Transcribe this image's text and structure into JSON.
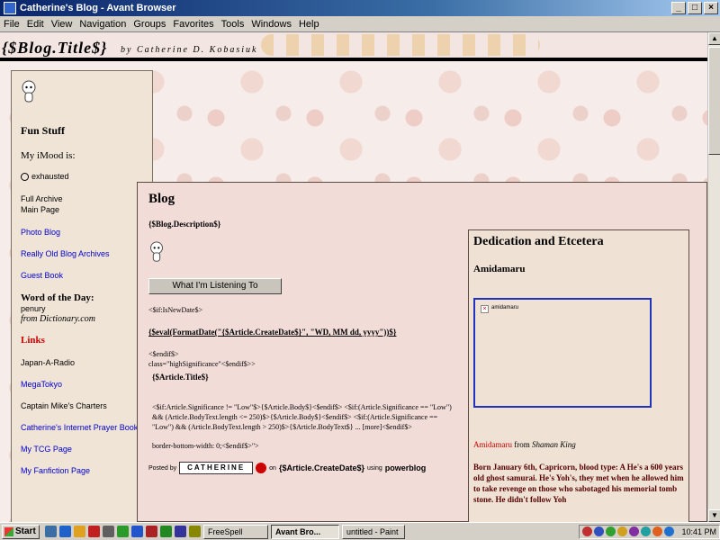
{
  "window": {
    "title": "Catherine's Blog - Avant Browser",
    "buttons": [
      "_",
      "□",
      "×"
    ]
  },
  "menu": [
    "File",
    "Edit",
    "View",
    "Navigation",
    "Groups",
    "Favorites",
    "Tools",
    "Windows",
    "Help"
  ],
  "blog": {
    "title": "{$Blog.Title$}",
    "byline": "by Catherine D. Kobasiuk"
  },
  "sidebar": {
    "fun_stuff": "Fun Stuff",
    "mood_label": "My iMood is:",
    "mood_value": "exhausted",
    "full_archive": "Full Archive",
    "main_page": "Main Page",
    "photo_blog": "Photo Blog",
    "old_archives": "Really Old Blog Archives",
    "guest_book": "Guest Book",
    "wotd_label": "Word of the Day:",
    "wotd_word": "penury",
    "wotd_source": "from Dictionary.com",
    "links_heading": "Links",
    "links": [
      "Japan-A-Radio",
      "MegaTokyo",
      "Captain Mike's Charters",
      "Catherine's Internet Prayer Book",
      "My TCG Page",
      "My Fanfiction Page"
    ]
  },
  "main": {
    "title": "Blog",
    "description": "{$Blog.Description$}",
    "listen_button": "What I'm Listening To",
    "code1": "<$if:IsNewDate$>",
    "code2": "{$eval(FormatDate(\"{$Article.CreateDate$}\", \"WD, MM dd, yyyy\"))$}",
    "code3": "<$endif$>",
    "code4": "class=\"highSignificance\"<$endif$>>",
    "article_title": "{$Article.Title$}",
    "code5": "<$if:Article.Significance != \"Low\"$>{$Article.Body$}<$endif$> <$if:(Article.Significance == \"Low\") && (Article.BodyText.length <= 250)$>{$Article.Body$}<$endif$> <$if:(Article.Significance == \"Low\") && (Article.BodyText.length > 250)$>{$Article.BodyText$} ... [more]<$endif$>",
    "code6": "border-bottom-width: 0;<$endif$>\">",
    "posted_by": "Posted by",
    "logo_text": "CATHERINE",
    "on_text": "on",
    "create_date": "{$Article.CreateDate$}",
    "using": "using",
    "powerblog": "powerblog"
  },
  "right_box": {
    "title": "Dedication and Etcetera",
    "subtitle": "Amidamaru",
    "image_alt": "amidamaru",
    "from_name": "Amidamaru",
    "from_word": "from",
    "from_source": "Shaman King",
    "body": "Born January 6th, Capricorn, blood type: A He's a 600 years old ghost samurai. He's Yoh's, they met when he allowed him to take revenge on those who sabotaged his memorial tomb stone. He didn't follow Yoh"
  },
  "taskbar": {
    "start": "Start",
    "tasks": [
      "FreeSpell",
      "Avant Bro...",
      "untitled - Paint"
    ],
    "clock": "10:41 PM"
  },
  "colors": {
    "titlebar": "#0a246a",
    "link": "#0000cc",
    "links_heading": "#cc0000",
    "image_border": "#2233bb"
  }
}
